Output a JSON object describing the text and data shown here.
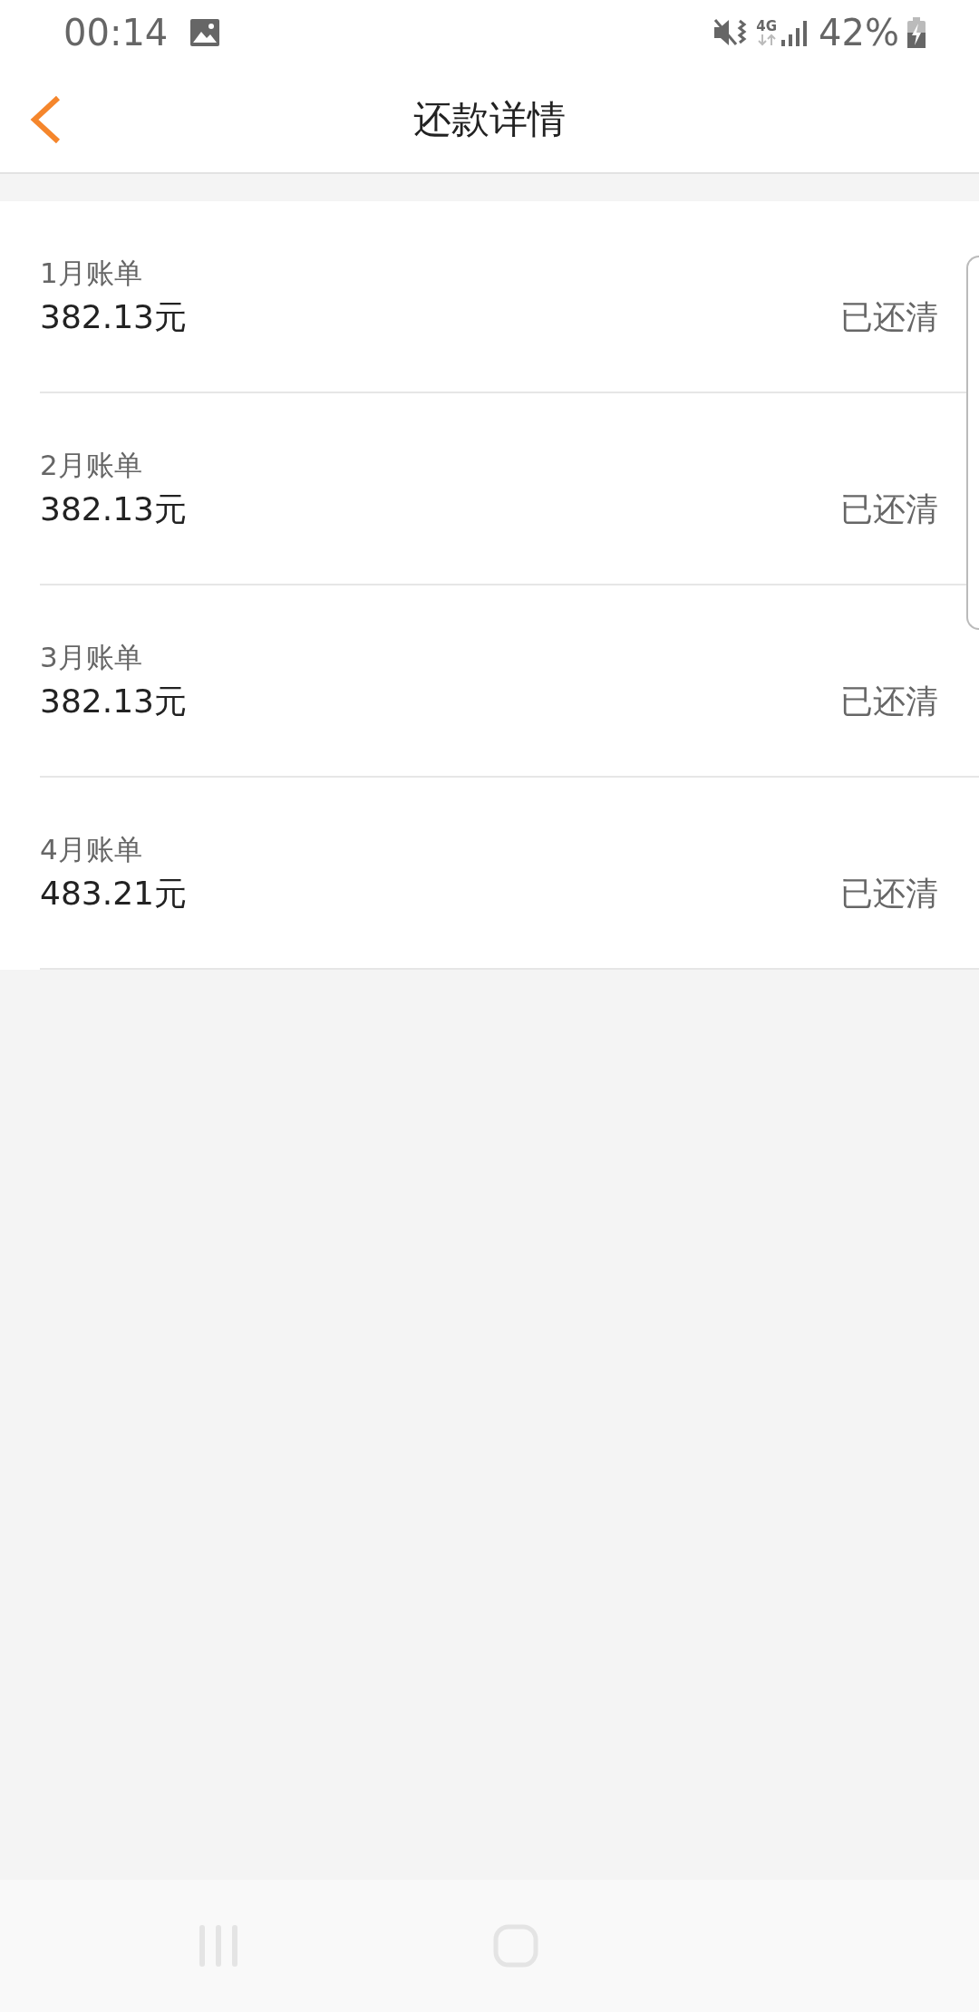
{
  "status_bar": {
    "time": "00:14",
    "network": "4G",
    "battery": "42%"
  },
  "header": {
    "title": "还款详情"
  },
  "bills": [
    {
      "label": "1月账单",
      "amount": "382.13元",
      "status": "已还清"
    },
    {
      "label": "2月账单",
      "amount": "382.13元",
      "status": "已还清"
    },
    {
      "label": "3月账单",
      "amount": "382.13元",
      "status": "已还清"
    },
    {
      "label": "4月账单",
      "amount": "483.21元",
      "status": "已还清"
    }
  ]
}
